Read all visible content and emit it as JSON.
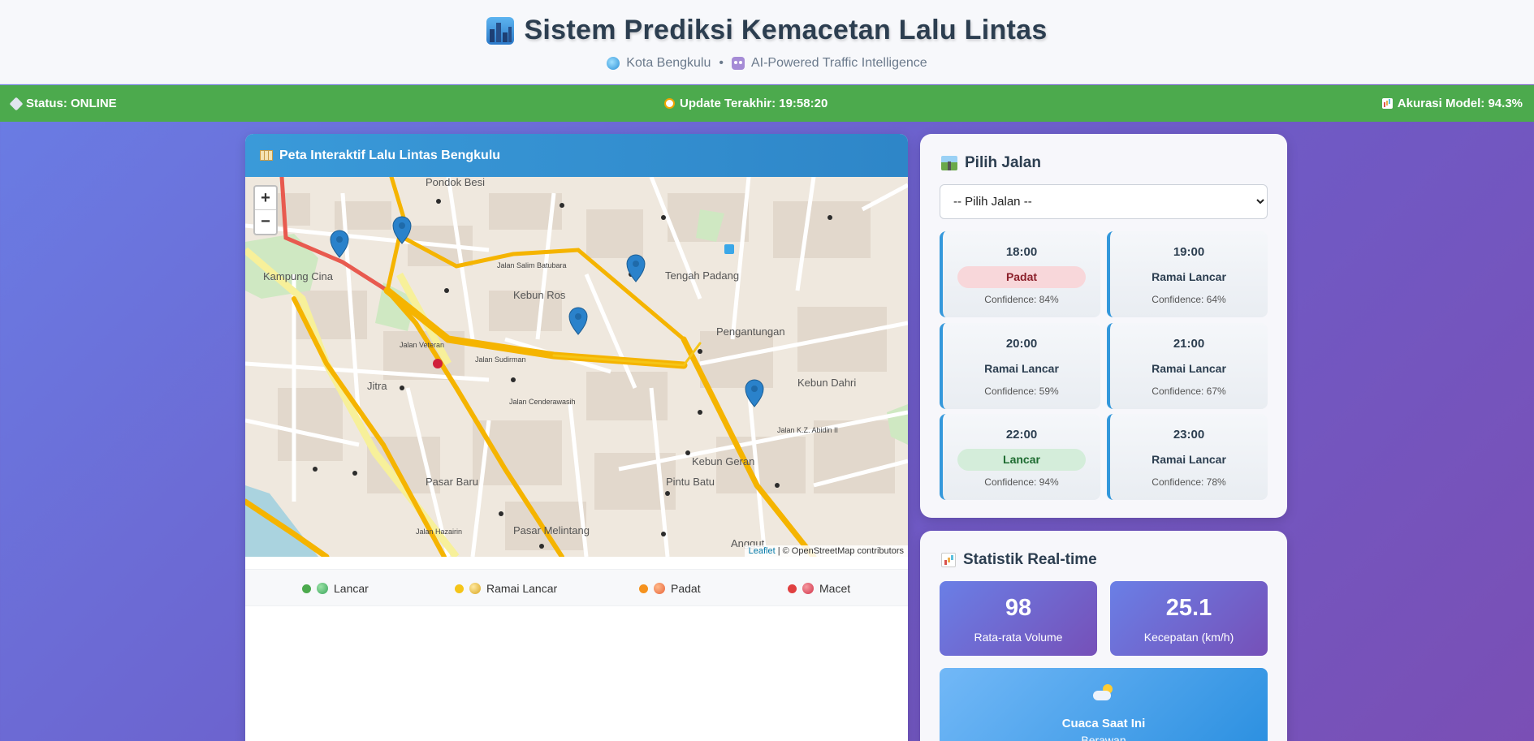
{
  "header": {
    "title": "Sistem Prediksi Kemacetan Lalu Lintas",
    "city": "Kota Bengkulu",
    "separator": "•",
    "tagline": "AI-Powered Traffic Intelligence"
  },
  "statusbar": {
    "status": "Status: ONLINE",
    "update": "Update Terakhir: 19:58:20",
    "accuracy": "Akurasi Model: 94.3%"
  },
  "map": {
    "title": "Peta Interaktif Lalu Lintas Bengkulu",
    "zoom_in": "+",
    "zoom_out": "−",
    "attribution_link": "Leaflet",
    "attribution_text": "| © OpenStreetMap contributors",
    "labels": [
      "Pondok Besi",
      "Kampung Cina",
      "Kebun Ros",
      "Tengah Padang",
      "Pengantungan",
      "Kebun Dahri",
      "Jitra",
      "Pasar Baru",
      "Kebun Geran",
      "Pintu Batu",
      "Pasar Melintang",
      "Anggut",
      "Jalan Sudirman",
      "Jalan Veteran",
      "Jalan Hazairin",
      "Jalan Cenderawasih",
      "Jalan Salim Batubara",
      "Jalan K.Z. Abidin II"
    ],
    "legend": [
      {
        "label": "Lancar",
        "color": "#4caa4d"
      },
      {
        "label": "Ramai Lancar",
        "color": "#f5c518"
      },
      {
        "label": "Padat",
        "color": "#f5921e"
      },
      {
        "label": "Macet",
        "color": "#e04040"
      }
    ]
  },
  "pilih_jalan": {
    "title": "Pilih Jalan",
    "select_value": "-- Pilih Jalan --",
    "predictions": [
      {
        "time": "18:00",
        "status": "Padat",
        "confidence": "Confidence: 84%"
      },
      {
        "time": "19:00",
        "status": "Ramai Lancar",
        "confidence": "Confidence: 64%"
      },
      {
        "time": "20:00",
        "status": "Ramai Lancar",
        "confidence": "Confidence: 59%"
      },
      {
        "time": "21:00",
        "status": "Ramai Lancar",
        "confidence": "Confidence: 67%"
      },
      {
        "time": "22:00",
        "status": "Lancar",
        "confidence": "Confidence: 94%"
      },
      {
        "time": "23:00",
        "status": "Ramai Lancar",
        "confidence": "Confidence: 78%"
      }
    ]
  },
  "statistik": {
    "title": "Statistik Real-time",
    "volume_value": "98",
    "volume_label": "Rata-rata Volume",
    "speed_value": "25.1",
    "speed_label": "Kecepatan (km/h)",
    "weather_title": "Cuaca Saat Ini",
    "weather_value": "Berawan"
  }
}
